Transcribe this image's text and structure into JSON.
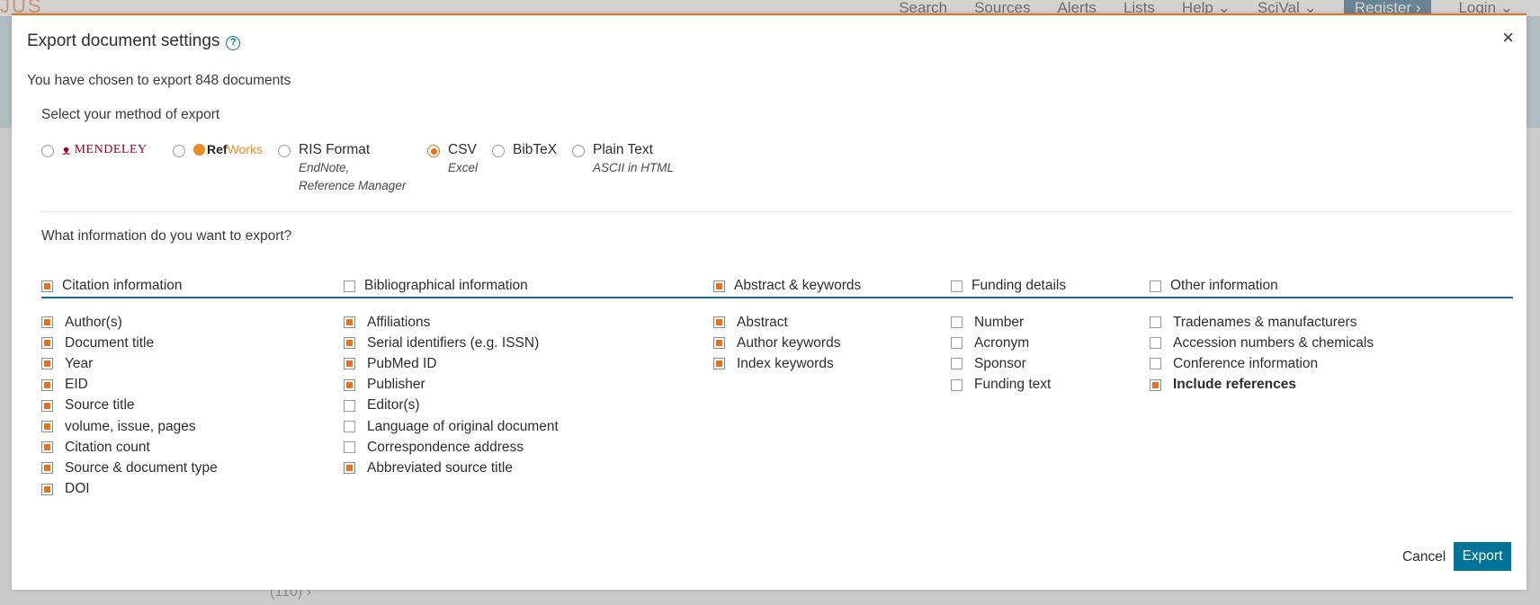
{
  "background": {
    "logo_fragment": "JUS",
    "nav": [
      "Search",
      "Sources",
      "Alerts",
      "Lists",
      "Help ⌄",
      "SciVal ⌄",
      "Register ›",
      "Login ⌄"
    ],
    "footer_text": "(110) ›"
  },
  "modal": {
    "title": "Export document settings",
    "help_icon": "?",
    "close_icon": "×",
    "subtitle": "You have chosen to export 848 documents",
    "method_label": "Select your method of export",
    "methods": [
      {
        "label": "MENDELEY",
        "sub": "",
        "checked": false,
        "icon": "mendeley-logo"
      },
      {
        "label_ref": "Ref",
        "label_works": "Works",
        "sub": "",
        "checked": false,
        "icon": "refworks-logo"
      },
      {
        "label": "RIS Format",
        "sub1": "EndNote,",
        "sub2": "Reference Manager",
        "checked": false
      },
      {
        "label": "CSV",
        "sub": "Excel",
        "checked": true
      },
      {
        "label": "BibTeX",
        "sub": "",
        "checked": false
      },
      {
        "label": "Plain Text",
        "sub": "ASCII in HTML",
        "checked": false
      }
    ],
    "info_label": "What information do you want to export?",
    "groups": [
      {
        "heading": "Citation information",
        "checked": true,
        "items": [
          {
            "label": "Author(s)",
            "checked": true
          },
          {
            "label": "Document title",
            "checked": true
          },
          {
            "label": "Year",
            "checked": true
          },
          {
            "label": "EID",
            "checked": true
          },
          {
            "label": "Source title",
            "checked": true
          },
          {
            "label": "volume, issue, pages",
            "checked": true
          },
          {
            "label": "Citation count",
            "checked": true
          },
          {
            "label": "Source & document type",
            "checked": true
          },
          {
            "label": "DOI",
            "checked": true
          }
        ]
      },
      {
        "heading": "Bibliographical information",
        "checked": false,
        "items": [
          {
            "label": "Affiliations",
            "checked": true
          },
          {
            "label": "Serial identifiers (e.g. ISSN)",
            "checked": true
          },
          {
            "label": "PubMed ID",
            "checked": true
          },
          {
            "label": "Publisher",
            "checked": true
          },
          {
            "label": "Editor(s)",
            "checked": false
          },
          {
            "label": "Language of original document",
            "checked": false
          },
          {
            "label": "Correspondence address",
            "checked": false
          },
          {
            "label": "Abbreviated source title",
            "checked": true
          }
        ]
      },
      {
        "heading": "Abstract & keywords",
        "checked": true,
        "items": [
          {
            "label": "Abstract",
            "checked": true
          },
          {
            "label": "Author keywords",
            "checked": true
          },
          {
            "label": "Index keywords",
            "checked": true
          }
        ]
      },
      {
        "heading": "Funding details",
        "checked": false,
        "items": [
          {
            "label": "Number",
            "checked": false
          },
          {
            "label": "Acronym",
            "checked": false
          },
          {
            "label": "Sponsor",
            "checked": false
          },
          {
            "label": "Funding text",
            "checked": false
          }
        ]
      },
      {
        "heading": "Other information",
        "checked": false,
        "items": [
          {
            "label": "Tradenames & manufacturers",
            "checked": false
          },
          {
            "label": "Accession numbers & chemicals",
            "checked": false
          },
          {
            "label": "Conference information",
            "checked": false
          },
          {
            "label": "Include references",
            "checked": true,
            "bold": true
          }
        ]
      }
    ],
    "cancel_label": "Cancel",
    "export_label": "Export",
    "colors": {
      "accent": "#e9711c",
      "primary": "#007398",
      "rule": "#1f6b8c"
    }
  }
}
